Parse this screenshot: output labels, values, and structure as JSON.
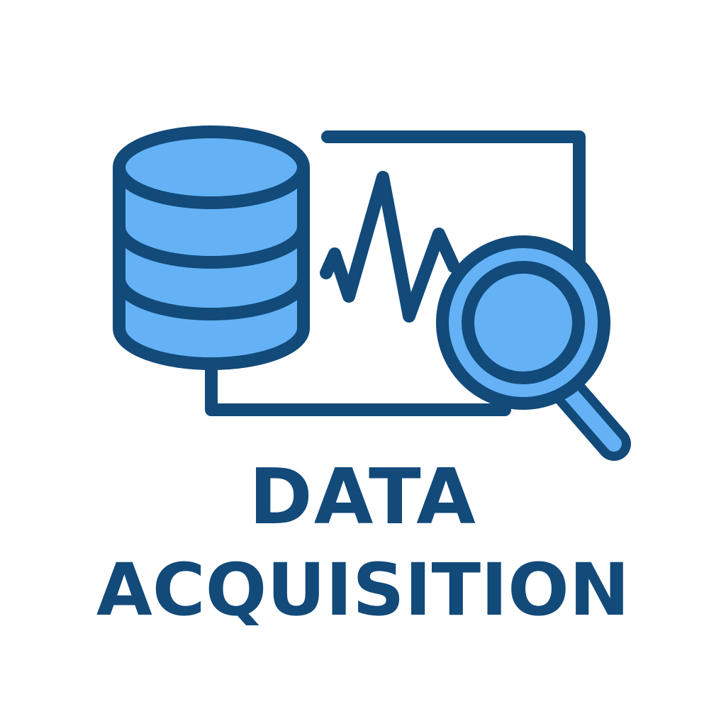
{
  "title": {
    "line1": "DATA",
    "line2": "ACQUISITION"
  },
  "icons": {
    "database": "database-icon",
    "chart": "signal-chart-icon",
    "magnifier": "magnifying-glass-icon"
  },
  "colors": {
    "background": "#ffffff",
    "outline": "#124a7a",
    "fill": "#64b2f5",
    "text": "#124a7a"
  }
}
